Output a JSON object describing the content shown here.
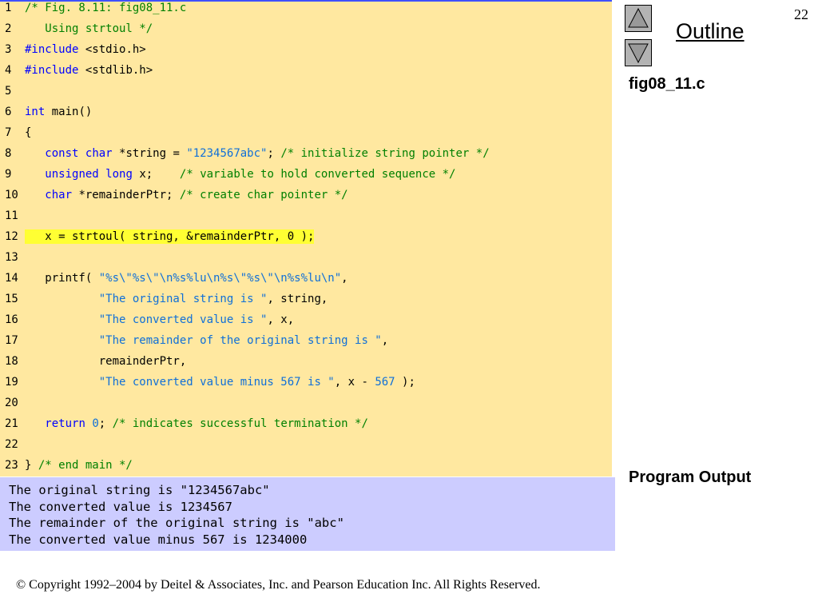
{
  "slide": {
    "page_number": "22",
    "copyright": "© Copyright 1992–2004 by Deitel & Associates, Inc. and Pearson Education Inc. All Rights Reserved."
  },
  "nav": {
    "outline_label": "Outline",
    "up_icon": "triangle-up-icon",
    "down_icon": "triangle-down-icon"
  },
  "sidebar": {
    "file_label": "fig08_11.c",
    "program_output_label": "Program Output"
  },
  "colors": {
    "code_background": "#ffe8a0",
    "output_background": "#ccccff",
    "comment": "#008000",
    "keyword": "#0000ff",
    "string": "#0f6fd8",
    "highlight": "#ffff33"
  },
  "code_lines": [
    {
      "num": "1",
      "highlight": false,
      "tokens": [
        [
          "comment",
          "/* Fig. 8.11: fig08_11.c"
        ]
      ]
    },
    {
      "num": "2",
      "highlight": false,
      "tokens": [
        [
          "comment",
          "   Using strtoul */"
        ]
      ]
    },
    {
      "num": "3",
      "highlight": false,
      "tokens": [
        [
          "keyword",
          "#include"
        ],
        [
          "plain",
          " <stdio.h>"
        ]
      ]
    },
    {
      "num": "4",
      "highlight": false,
      "tokens": [
        [
          "keyword",
          "#include"
        ],
        [
          "plain",
          " <stdlib.h>"
        ]
      ]
    },
    {
      "num": "5",
      "highlight": false,
      "tokens": []
    },
    {
      "num": "6",
      "highlight": false,
      "tokens": [
        [
          "keyword",
          "int"
        ],
        [
          "plain",
          " main()"
        ]
      ]
    },
    {
      "num": "7",
      "highlight": false,
      "tokens": [
        [
          "plain",
          "{"
        ]
      ]
    },
    {
      "num": "8",
      "highlight": false,
      "tokens": [
        [
          "plain",
          "   "
        ],
        [
          "keyword",
          "const"
        ],
        [
          "plain",
          " "
        ],
        [
          "keyword",
          "char"
        ],
        [
          "plain",
          " *string = "
        ],
        [
          "string",
          "\"1234567abc\""
        ],
        [
          "plain",
          "; "
        ],
        [
          "comment",
          "/* initialize string pointer */"
        ]
      ]
    },
    {
      "num": "9",
      "highlight": false,
      "tokens": [
        [
          "plain",
          "   "
        ],
        [
          "keyword",
          "unsigned"
        ],
        [
          "plain",
          " "
        ],
        [
          "keyword",
          "long"
        ],
        [
          "plain",
          " x;    "
        ],
        [
          "comment",
          "/* variable to hold converted sequence */"
        ]
      ]
    },
    {
      "num": "10",
      "highlight": false,
      "tokens": [
        [
          "plain",
          "   "
        ],
        [
          "keyword",
          "char"
        ],
        [
          "plain",
          " *remainderPtr; "
        ],
        [
          "comment",
          "/* create char pointer */"
        ]
      ]
    },
    {
      "num": "11",
      "highlight": false,
      "tokens": []
    },
    {
      "num": "12",
      "highlight": true,
      "tokens": [
        [
          "plain",
          "   x = strtoul( string, &remainderPtr, 0 );"
        ]
      ]
    },
    {
      "num": "13",
      "highlight": false,
      "tokens": []
    },
    {
      "num": "14",
      "highlight": false,
      "tokens": [
        [
          "plain",
          "   printf( "
        ],
        [
          "string",
          "\"%s\\\"%s\\\"\\n%s%lu\\n%s\\\"%s\\\"\\n%s%lu\\n\""
        ],
        [
          "plain",
          ","
        ]
      ]
    },
    {
      "num": "15",
      "highlight": false,
      "tokens": [
        [
          "plain",
          "           "
        ],
        [
          "string",
          "\"The original string is \""
        ],
        [
          "plain",
          ", string,"
        ]
      ]
    },
    {
      "num": "16",
      "highlight": false,
      "tokens": [
        [
          "plain",
          "           "
        ],
        [
          "string",
          "\"The converted value is \""
        ],
        [
          "plain",
          ", x,"
        ]
      ]
    },
    {
      "num": "17",
      "highlight": false,
      "tokens": [
        [
          "plain",
          "           "
        ],
        [
          "string",
          "\"The remainder of the original string is \""
        ],
        [
          "plain",
          ","
        ]
      ]
    },
    {
      "num": "18",
      "highlight": false,
      "tokens": [
        [
          "plain",
          "           remainderPtr,"
        ]
      ]
    },
    {
      "num": "19",
      "highlight": false,
      "tokens": [
        [
          "plain",
          "           "
        ],
        [
          "string",
          "\"The converted value minus 567 is \""
        ],
        [
          "plain",
          ", x - "
        ],
        [
          "number",
          "567"
        ],
        [
          "plain",
          " );"
        ]
      ]
    },
    {
      "num": "20",
      "highlight": false,
      "tokens": []
    },
    {
      "num": "21",
      "highlight": false,
      "tokens": [
        [
          "plain",
          "   "
        ],
        [
          "keyword",
          "return"
        ],
        [
          "plain",
          " "
        ],
        [
          "number",
          "0"
        ],
        [
          "plain",
          "; "
        ],
        [
          "comment",
          "/* indicates successful termination */"
        ]
      ]
    },
    {
      "num": "22",
      "highlight": false,
      "tokens": []
    },
    {
      "num": "23",
      "highlight": false,
      "tokens": [
        [
          "plain",
          "} "
        ],
        [
          "comment",
          "/* end main */"
        ]
      ]
    }
  ],
  "output_lines": [
    "The original string is \"1234567abc\"",
    "The converted value is 1234567",
    "The remainder of the original string is \"abc\"",
    "The converted value minus 567 is 1234000"
  ]
}
